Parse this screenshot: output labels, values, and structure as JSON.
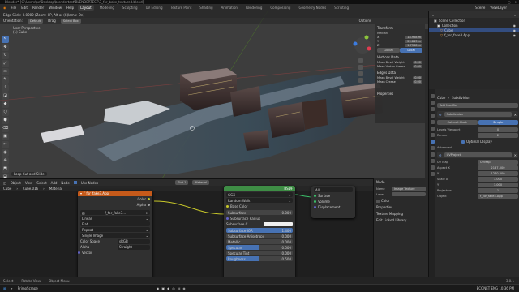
{
  "titlebar": {
    "text": "Blender* [C:\\Users\\pc\\Desktop\\blendertest\\BLENDERTEST\\3_for_bake_textured.blend]"
  },
  "menubar": {
    "items": [
      "File",
      "Edit",
      "Render",
      "Window",
      "Help"
    ],
    "tabs": [
      "Layout",
      "Modeling",
      "Sculpting",
      "UV Editing",
      "Texture Paint",
      "Shading",
      "Animation",
      "Rendering",
      "Compositing",
      "Geometry Nodes",
      "Scripting"
    ],
    "active_tab": "Layout",
    "scene_label": "Scene",
    "view_layer": "ViewLayer"
  },
  "viewport": {
    "mode": "Edge Slide: 0.0000 (Zoom: 0P, Alt or (C)lamp: On)",
    "orientation": "Default",
    "drag": "Drag",
    "select": "Select Box",
    "view_label": "User Perspective",
    "object_label": "(1) Cube",
    "options": "Options",
    "tools": [
      "↖",
      "✥",
      "↻",
      "⤢",
      "▭",
      "✎",
      "⟟",
      "◪",
      "◆",
      "⬡",
      "⬢",
      "⌫",
      "▣",
      "✂",
      "◉",
      "⊕",
      "⬒",
      "⬓"
    ],
    "footer": "Loop Cut and Slide"
  },
  "npanel": {
    "transform_title": "Transform",
    "median_label": "Median",
    "median": [
      {
        "axis": "X",
        "value": "18.958 m"
      },
      {
        "axis": "Y",
        "value": "25.843 m"
      },
      {
        "axis": "Z",
        "value": "1.7388 m"
      }
    ],
    "global": "Global",
    "local": "Local",
    "vertex_title": "Vertices Data",
    "vertex": [
      {
        "label": "Mean Bevel Weight",
        "value": "0.00"
      },
      {
        "label": "Mean Vertex Crease",
        "value": "0.00"
      }
    ],
    "edges_title": "Edges Data",
    "edges": [
      {
        "label": "Mean Bevel Weight",
        "value": "0.00"
      },
      {
        "label": "Mean Crease",
        "value": "0.00"
      }
    ],
    "properties_title": "Properties"
  },
  "outliner": {
    "header": "Scene Collection",
    "items": [
      {
        "label": "Collection",
        "selected": false
      },
      {
        "label": "Cube",
        "selected": true
      },
      {
        "label": "f_for_fake3.App",
        "selected": false
      }
    ]
  },
  "properties": {
    "object_name": "Cube",
    "modifier_tab": "Subdivision",
    "add_modifier": "Add Modifier",
    "subdiv_name": "Subdivision",
    "catmull": "Catmull-Clark",
    "simple": "Simple",
    "levels_viewport_label": "Levels Viewport",
    "levels_viewport": "0",
    "render_label": "Render",
    "render": "2",
    "optimal_display": "Optimal Display",
    "advanced": "Advanced",
    "uvproject_name": "UVProject",
    "uv_map_label": "UV Map",
    "uv_map": "UVMap",
    "aspect_x_label": "Aspect X",
    "aspect_x": "2137.000",
    "y_label": "Y",
    "y": "1270.000",
    "scale_x_label": "Scale X",
    "scale_x": "1.000",
    "scale_y_label": "Y",
    "scale_y": "1.000",
    "projectors_label": "Projectors",
    "projectors": "1",
    "object_label": "Object",
    "object": "f_for_fake3.App"
  },
  "nodeeditor": {
    "header_items": [
      "Object",
      "View",
      "Select",
      "Add",
      "Node"
    ],
    "use_nodes": "Use Nodes",
    "slot": "Slot 1",
    "material": "Material",
    "breadcrumb": [
      "Cube",
      "Cube.016",
      "Material"
    ],
    "image_node": {
      "title": "f_for_fake3.App",
      "out_color": "Color",
      "out_alpha": "Alpha",
      "image": "f_for_fake3...",
      "interp": "Linear",
      "proj": "Flat",
      "ext": "Repeat",
      "source": "Single Image",
      "cs_label": "Color Space",
      "cs": "sRGB",
      "alpha_label": "Alpha",
      "alpha": "Straight",
      "vector": "Vector"
    },
    "bsdf_node": {
      "title": "BSDF",
      "dist": "GGX",
      "sss": "Random Walk",
      "inputs": [
        {
          "label": "Base Color",
          "value": ""
        },
        {
          "label": "Subsurface",
          "value": "0.000"
        },
        {
          "label": "Subsurface Radius",
          "value": ""
        },
        {
          "label": "Subsurface C...",
          "value": ""
        },
        {
          "label": "Subsurface IOR",
          "value": "1.400"
        },
        {
          "label": "Subsurface Anisotropy",
          "value": "0.000"
        },
        {
          "label": "Metallic",
          "value": "0.000"
        },
        {
          "label": "Specular",
          "value": "0.500"
        },
        {
          "label": "Specular Tint",
          "value": "0.000"
        },
        {
          "label": "Roughness",
          "value": "0.500"
        }
      ]
    },
    "output_node": {
      "title": "All",
      "inputs": [
        "Surface",
        "Volume",
        "Displacement"
      ]
    }
  },
  "node_panel": {
    "title": "Node",
    "name_label": "Name",
    "name": "Image Texture",
    "label_label": "Label",
    "color": "Color",
    "properties": "Properties",
    "texture_mapping": "Texture Mapping",
    "edit_linked": "Edit Linked Library"
  },
  "statusbar": {
    "items": [
      "Select",
      "Rotate View",
      "Object Menu"
    ],
    "version": "3.0.1"
  },
  "taskbar": {
    "items": [
      "PrimoScrape"
    ],
    "right": "ECONET ENG 10:36 PM"
  },
  "colors": {
    "accent": "#4772b3",
    "image_node": "#c65a1a",
    "bsdf_node": "#3e8d45",
    "output_node": "#b02020",
    "link": "#c7c729"
  }
}
